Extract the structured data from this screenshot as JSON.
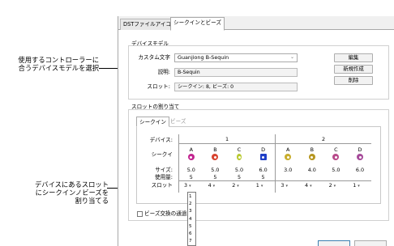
{
  "annotations": {
    "model_callout_line1": "使用するコントローラーに",
    "model_callout_line2": "合うデバイスモデルを選択",
    "slot_callout_line1": "デバイスにあるスロット",
    "slot_callout_line2": "にシークインノビーズを",
    "slot_callout_line3": "割り当てる"
  },
  "tabs": [
    {
      "label": "DSTファイルアイコン",
      "active": false
    },
    {
      "label": "シークインとビーズ",
      "active": true
    }
  ],
  "device_model": {
    "group_title": "デバイスモデル",
    "custom_label": "カスタム文字",
    "custom_value": "Guanjiong B-Sequin",
    "description_label": "説明:",
    "description_value": "B-Sequin",
    "slot_label": "スロット:",
    "slot_value": "シークイン: 8, ビーズ: 0",
    "buttons": [
      "編集",
      "新規作成",
      "削除"
    ]
  },
  "slot_assignment": {
    "group_title": "スロットの割り当て",
    "subtabs": [
      {
        "label": "シークイン",
        "active": true
      },
      {
        "label": "ビーズ",
        "active": false
      }
    ],
    "row_labels": {
      "device": "デバイス:",
      "sequin": "シークイ",
      "size": "サイズ:",
      "usage": "使用量:",
      "slot": "スロット"
    },
    "devices": [
      "1",
      "2"
    ],
    "columns": [
      {
        "letter": "A",
        "color": "#c22590",
        "shape": "circle",
        "size": "5.0",
        "usage": "5",
        "slot": "3"
      },
      {
        "letter": "B",
        "color": "#d8432e",
        "shape": "circle",
        "size": "5.0",
        "usage": "5",
        "slot": "4"
      },
      {
        "letter": "C",
        "color": "#b8c92e",
        "shape": "oval",
        "size": "5.0",
        "usage": "5",
        "slot": "2"
      },
      {
        "letter": "D",
        "color": "#1f3fc7",
        "shape": "square",
        "size": "6.0",
        "usage": "5",
        "slot": "1"
      },
      {
        "letter": "A",
        "color": "#c8ad2c",
        "shape": "circle",
        "size": "3.0",
        "usage": "",
        "slot": "3"
      },
      {
        "letter": "B",
        "color": "#b69620",
        "shape": "circle",
        "size": "4.0",
        "usage": "",
        "slot": "4"
      },
      {
        "letter": "C",
        "color": "#b84a8a",
        "shape": "circle",
        "size": "5.0",
        "usage": "",
        "slot": "2"
      },
      {
        "letter": "D",
        "color": "#a64a9a",
        "shape": "circle",
        "size": "6.0",
        "usage": "",
        "slot": "1"
      }
    ],
    "dropdown_options": [
      "1",
      "2",
      "3",
      "4",
      "5",
      "6",
      "7"
    ],
    "checkbox_label": "ビーズ交換の通過"
  }
}
